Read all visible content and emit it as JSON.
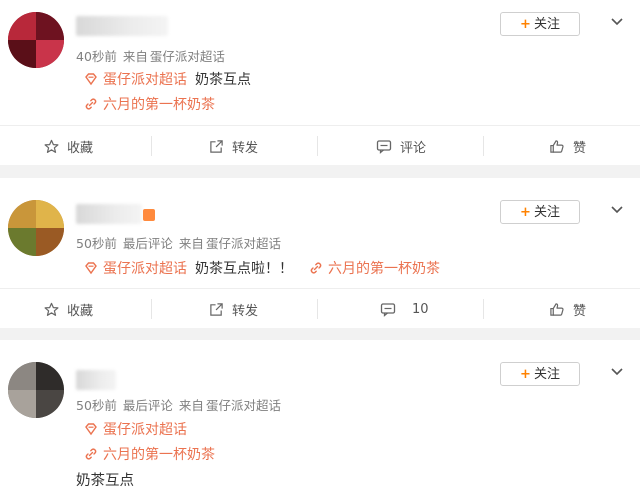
{
  "follow_label": "关注",
  "posts": [
    {
      "time": "40秒前",
      "via": "来自",
      "source": "蛋仔派对超话",
      "topic": "蛋仔派对超话",
      "text": "奶茶互点",
      "link": "六月的第一杯奶茶",
      "actions": {
        "fav": "收藏",
        "repost": "转发",
        "comment": "评论",
        "like": "赞"
      }
    },
    {
      "time": "50秒前",
      "last_comment": "最后评论",
      "via": "来自",
      "source": "蛋仔派对超话",
      "topic": "蛋仔派对超话",
      "text": "奶茶互点啦！！",
      "link": "六月的第一杯奶茶",
      "actions": {
        "fav": "收藏",
        "repost": "转发",
        "comment": "10",
        "like": "赞"
      }
    },
    {
      "time": "50秒前",
      "last_comment": "最后评论",
      "via": "来自",
      "source": "蛋仔派对超话",
      "topic": "蛋仔派对超话",
      "link": "六月的第一杯奶茶",
      "body": "奶茶互点"
    }
  ],
  "colors": {
    "accent": "#ff8200",
    "link": "#eb7350",
    "meta": "#808080"
  }
}
